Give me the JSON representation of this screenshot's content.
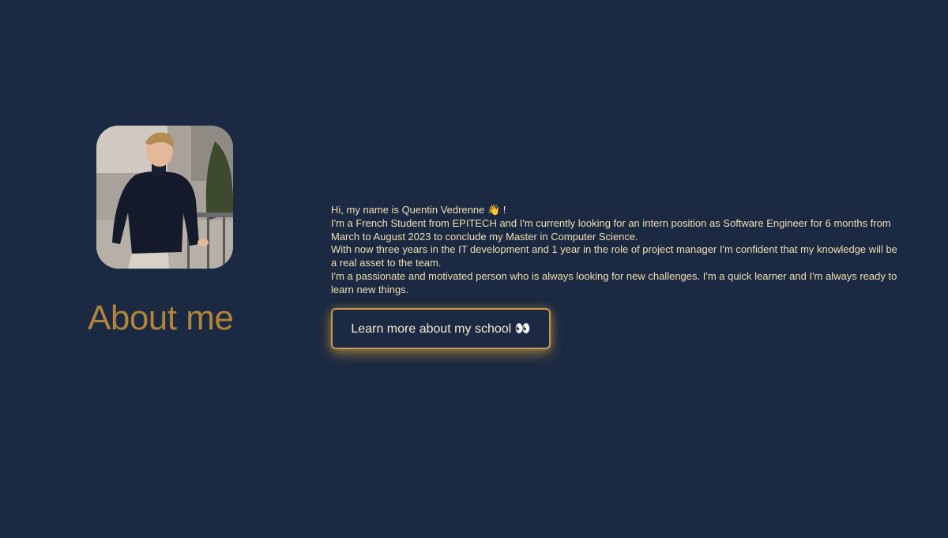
{
  "about": {
    "title": "About me",
    "photo_alt": "Quentin Vedrenne portrait",
    "bio_lines": [
      "Hi, my name is Quentin Vedrenne 👋 !",
      "I'm a French Student from EPITECH and I'm currently looking for an intern position as Software Engineer for 6 months from March to August 2023 to conclude my Master in Computer Science.",
      "With now three years in the IT development and 1 year in the role of project manager I'm confident that my knowledge will be a real asset to the team.",
      "I'm a passionate and motivated person who is always looking for new challenges. I'm a quick learner and I'm always ready to learn new things."
    ],
    "button_label": "Learn more about my school 👀"
  },
  "colors": {
    "background": "#1b2942",
    "title": "#b0843a",
    "body_text": "#f3dfb3",
    "button_border": "#c49a4e"
  }
}
